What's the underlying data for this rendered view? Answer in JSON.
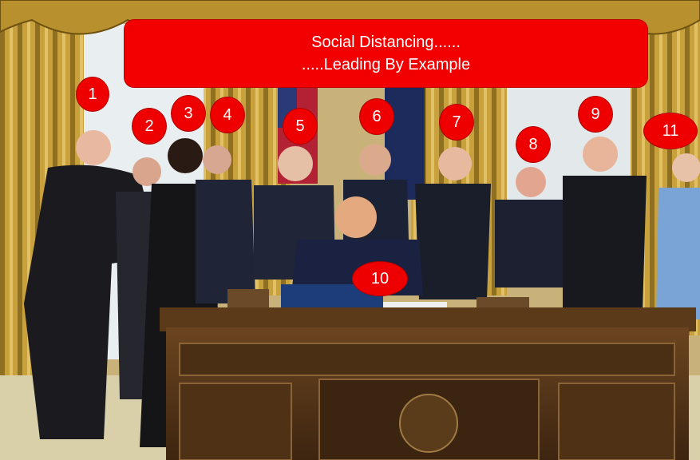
{
  "caption": {
    "line1": "Social Distancing......",
    "line2": ".....Leading By Example"
  },
  "markers": [
    "1",
    "2",
    "3",
    "4",
    "5",
    "6",
    "7",
    "8",
    "9",
    "10",
    "11"
  ],
  "colors": {
    "marker_red": "#ee0000",
    "banner_red": "#f20000"
  }
}
